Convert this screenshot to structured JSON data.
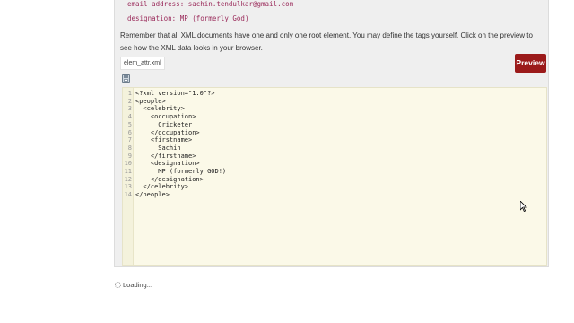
{
  "snippet": {
    "email_line": "email address: sachin.tendulkar@gmail.com",
    "designation_line": "designation: MP (formerly God)"
  },
  "description": "Remember that all XML documents have one and only one root element. You may define the tags yourself. Click on the preview to see how the XML data looks in your browser.",
  "file_tab": "elem_attr.xml",
  "preview_button": "Preview",
  "accent_color": "#9b1a1a",
  "icons": [
    "save-icon",
    "loading-icon",
    "mouse-cursor-icon"
  ],
  "editor": {
    "lines": [
      {
        "no": "1",
        "text": "<?xml version=\"1.0\"?>"
      },
      {
        "no": "2",
        "text": "<people>"
      },
      {
        "no": "3",
        "text": "  <celebrity>"
      },
      {
        "no": "4",
        "text": "    <occupation>"
      },
      {
        "no": "5",
        "text": "      Cricketer"
      },
      {
        "no": "6",
        "text": "    </occupation>"
      },
      {
        "no": "7",
        "text": "    <firstname>"
      },
      {
        "no": "8",
        "text": "      Sachin"
      },
      {
        "no": "9",
        "text": "    </firstname>"
      },
      {
        "no": "10",
        "text": "    <designation>"
      },
      {
        "no": "11",
        "text": "      MP (formerly GOD!)"
      },
      {
        "no": "12",
        "text": "    </designation>"
      },
      {
        "no": "13",
        "text": "  </celebrity>"
      },
      {
        "no": "14",
        "text": "</people>"
      }
    ]
  },
  "status": {
    "loading": "Loading..."
  }
}
